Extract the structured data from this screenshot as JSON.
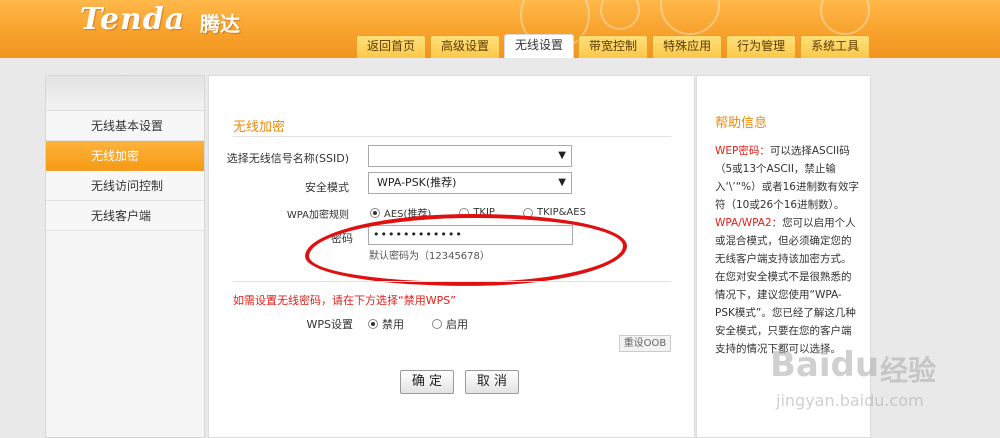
{
  "brand": {
    "logo": "Tenda",
    "logo_cn": "腾达"
  },
  "nav_tabs": [
    {
      "label": "返回首页"
    },
    {
      "label": "高级设置"
    },
    {
      "label": "无线设置"
    },
    {
      "label": "带宽控制"
    },
    {
      "label": "特殊应用"
    },
    {
      "label": "行为管理"
    },
    {
      "label": "系统工具"
    }
  ],
  "sidebar": {
    "items": [
      {
        "label": "无线基本设置"
      },
      {
        "label": "无线加密"
      },
      {
        "label": "无线访问控制"
      },
      {
        "label": "无线客户端"
      }
    ]
  },
  "main": {
    "section_title": "无线加密",
    "ssid_label": "选择无线信号名称(SSID)",
    "ssid_value": "",
    "security_label": "安全模式",
    "security_value": "WPA-PSK(推荐)",
    "wpa_rule_label": "WPA加密规则",
    "wpa_rule_options": [
      "AES(推荐)",
      "TKIP",
      "TKIP&AES"
    ],
    "password_label": "密码",
    "password_value": "••••••••••••",
    "password_hint": "默认密码为（12345678）",
    "wps_warning": "如需设置无线密码，请在下方选择“禁用WPS”",
    "wps_label": "WPS设置",
    "wps_options": [
      "禁用",
      "启用"
    ],
    "reset_oob": "重设OOB",
    "ok_label": "确 定",
    "cancel_label": "取 消"
  },
  "help": {
    "title": "帮助信息",
    "wep_key": "WEP密码：",
    "wep_text": "可以选择ASCII码（5或13个ASCII，禁止输入‘\\’“%）或者16进制数有效字符（10或26个16进制数）。",
    "wpa_key": "WPA/WPA2：",
    "wpa_text": "您可以启用个人或混合模式，但必须确定您的无线客户端支持该加密方式。",
    "extra_text": "在您对安全模式不是很熟悉的情况下，建议您使用“WPA-PSK模式”。您已经了解这几种安全模式，只要在您的客户端支持的情况下都可以选择。"
  },
  "watermark": {
    "brand": "Baidu",
    "cn": "经验",
    "url": "jingyan.baidu.com"
  },
  "colors": {
    "header": "#f7a02a",
    "accent": "#f08a0a",
    "warning": "#e0201a",
    "annotation": "#e01010"
  }
}
